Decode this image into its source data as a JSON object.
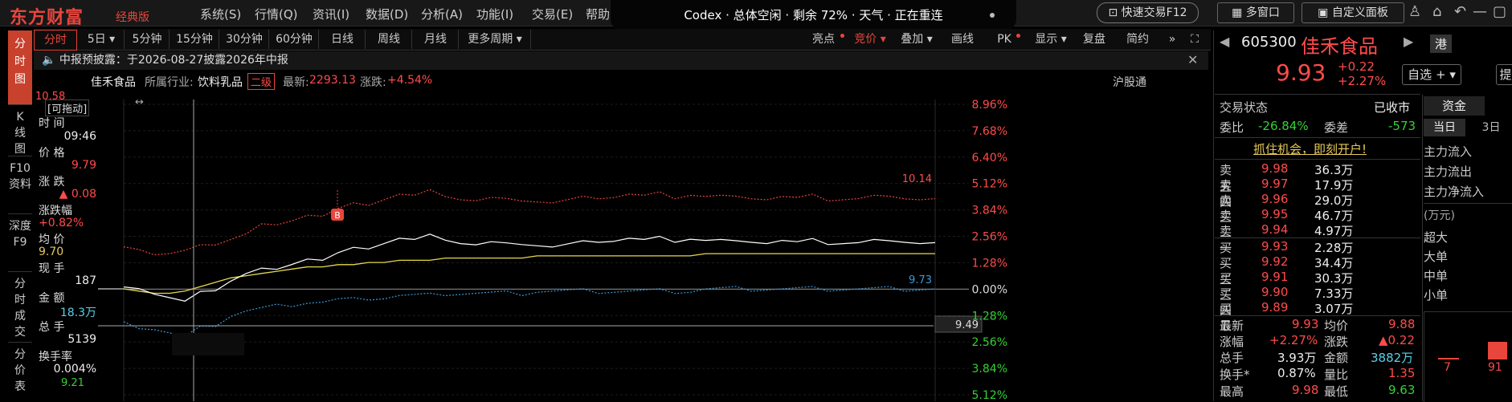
{
  "topbar": {
    "logo": "东方财富",
    "logo_sub": "经典版",
    "menus": [
      "系统(S)",
      "行情(Q)",
      "资讯(I)",
      "数据(D)",
      "分析(A)",
      "功能(I)",
      "交易(E)",
      "帮助"
    ],
    "codex": "Codex · 总体空闲 · 剩余 72% · 天气 · 正在重连",
    "quick_trade": "快速交易F12",
    "multi_window": "多窗口",
    "custom_panel": "自定义面板"
  },
  "left_tabs": [
    "分时图",
    "K线图",
    "F10资料",
    "深度F9",
    "分时成交",
    "分价表"
  ],
  "toolbar": {
    "periods": [
      "分时",
      "5日",
      "5分钟",
      "15分钟",
      "30分钟",
      "60分钟",
      "日线",
      "周线",
      "月线",
      "更多周期"
    ],
    "right_buttons": [
      "亮点",
      "竞价",
      "叠加",
      "画线",
      "PK",
      "显示",
      "复盘",
      "简约"
    ]
  },
  "notice": "中报预披露：于2026-08-27披露2026年中报",
  "info": {
    "name": "佳禾食品",
    "industry_label": "所属行业:",
    "industry": "饮料乳品",
    "level": "二级",
    "latest_label": "最新:",
    "latest": "2293.13",
    "change_label": "涨跌:",
    "change": "+4.54%",
    "hsgt": "沪股通"
  },
  "panel": {
    "draggable": "[可拖动]",
    "time_label": "时 间",
    "time": "09:46",
    "price_label": "价 格",
    "price": "9.79",
    "chg_label": "涨 跌",
    "chg": "▲ 0.08",
    "pct_label": "涨跌幅",
    "pct": "+0.82%",
    "avg_label": "均 价",
    "avg": "9.70",
    "vol_label": "现 手",
    "vol": "187",
    "amt_label": "金 额",
    "amt": "18.3万",
    "total_label": "总 手",
    "total": "5139",
    "turn_label": "换手率",
    "turn": "0.004%"
  },
  "axis": {
    "left_top": "10.58",
    "left_bottom": "9.21",
    "right_labels": [
      "8.96%",
      "7.68%",
      "6.40%",
      "5.12%",
      "3.84%",
      "2.56%",
      "1.28%",
      "0.00%",
      "1.28%",
      "2.56%",
      "3.84%",
      "5.12%"
    ],
    "upper_band_label": "10.14",
    "lower_band_label": "9.73",
    "crosshair_price": "9.49",
    "marker": "B"
  },
  "quote": {
    "code": "605300",
    "name": "佳禾食品",
    "market": "港",
    "price": "9.93",
    "chg": "+0.22",
    "pct": "+2.27%",
    "watch": "自选",
    "watch_icon": "plus-icon",
    "extra": "提",
    "status_label": "交易状态",
    "status": "已收市",
    "wb_label": "委比",
    "wb": "-26.84%",
    "wc_label": "委差",
    "wc": "-573",
    "promo": "抓住机会，即刻开户!",
    "sells": [
      {
        "label": "卖五",
        "price": "9.98",
        "vol": "36.3万"
      },
      {
        "label": "卖四",
        "price": "9.97",
        "vol": "17.9万"
      },
      {
        "label": "卖三",
        "price": "9.96",
        "vol": "29.0万"
      },
      {
        "label": "卖二",
        "price": "9.95",
        "vol": "46.7万"
      },
      {
        "label": "卖一",
        "price": "9.94",
        "vol": "4.97万"
      }
    ],
    "buys": [
      {
        "label": "买一",
        "price": "9.93",
        "vol": "2.28万"
      },
      {
        "label": "买二",
        "price": "9.92",
        "vol": "34.4万"
      },
      {
        "label": "买三",
        "price": "9.91",
        "vol": "30.3万"
      },
      {
        "label": "买四",
        "price": "9.90",
        "vol": "7.33万"
      },
      {
        "label": "买五",
        "price": "9.89",
        "vol": "3.07万"
      }
    ],
    "stats": [
      {
        "l1": "最新",
        "v1": "9.93",
        "l2": "均价",
        "v2": "9.88"
      },
      {
        "l1": "涨幅",
        "v1": "+2.27%",
        "l2": "涨跌",
        "v2": "▲0.22"
      },
      {
        "l1": "总手",
        "v1": "3.93万",
        "l2": "金额",
        "v2": "3882万"
      },
      {
        "l1": "换手*",
        "v1": "0.87%",
        "l2": "量比",
        "v2": "1.35"
      },
      {
        "l1": "最高",
        "v1": "9.98",
        "l2": "最低",
        "v2": "9.63"
      }
    ],
    "fund_tab": "资金",
    "fund_days": [
      "当日",
      "3日"
    ],
    "fund_items": [
      "主力流入",
      "主力流出",
      "主力净流入"
    ],
    "unit": "(万元)",
    "size_items": [
      "超大",
      "大单",
      "中单",
      "小单"
    ],
    "bar_values": [
      "7",
      "91"
    ]
  },
  "chart_data": {
    "type": "line",
    "ylim": [
      9.21,
      10.58
    ],
    "series": [
      {
        "values": [
          9.72,
          9.73,
          9.7,
          9.68,
          9.66,
          9.7,
          9.72,
          9.76,
          9.79,
          9.81,
          9.8,
          9.84,
          9.86,
          9.85,
          9.88,
          9.9,
          9.91,
          9.93,
          9.95,
          9.94,
          9.96,
          9.95,
          9.93,
          9.92,
          9.93,
          9.92,
          9.93,
          9.92,
          9.91,
          9.92,
          9.93,
          9.94,
          9.94,
          9.95,
          9.94,
          9.95,
          9.94,
          9.95,
          9.94,
          9.94,
          9.93,
          9.94,
          9.93,
          9.94,
          9.93,
          9.94,
          9.93,
          9.93,
          9.93,
          9.94,
          9.93,
          9.94,
          9.93,
          9.93
        ]
      },
      {
        "values": [
          9.72,
          9.71,
          9.7,
          9.7,
          9.71,
          9.73,
          9.75,
          9.77,
          9.78,
          9.79,
          9.8,
          9.81,
          9.82,
          9.82,
          9.83,
          9.83,
          9.84,
          9.84,
          9.85,
          9.85,
          9.85,
          9.86,
          9.86,
          9.86,
          9.86,
          9.86,
          9.86,
          9.87,
          9.87,
          9.87,
          9.87,
          9.87,
          9.87,
          9.87,
          9.87,
          9.87,
          9.87,
          9.87,
          9.88,
          9.88,
          9.88,
          9.88,
          9.88,
          9.88,
          9.88,
          9.88,
          9.88,
          9.88,
          9.88,
          9.88,
          9.88,
          9.88,
          9.88,
          9.88
        ]
      }
    ]
  },
  "colors": {
    "accent": "#e8453c",
    "up": "#ff4b4b",
    "down": "#35d035",
    "price_line": "#ffffff",
    "avg_line": "#e6d94a",
    "band_up": "#e8453c",
    "band_down": "#3a9ad9"
  }
}
